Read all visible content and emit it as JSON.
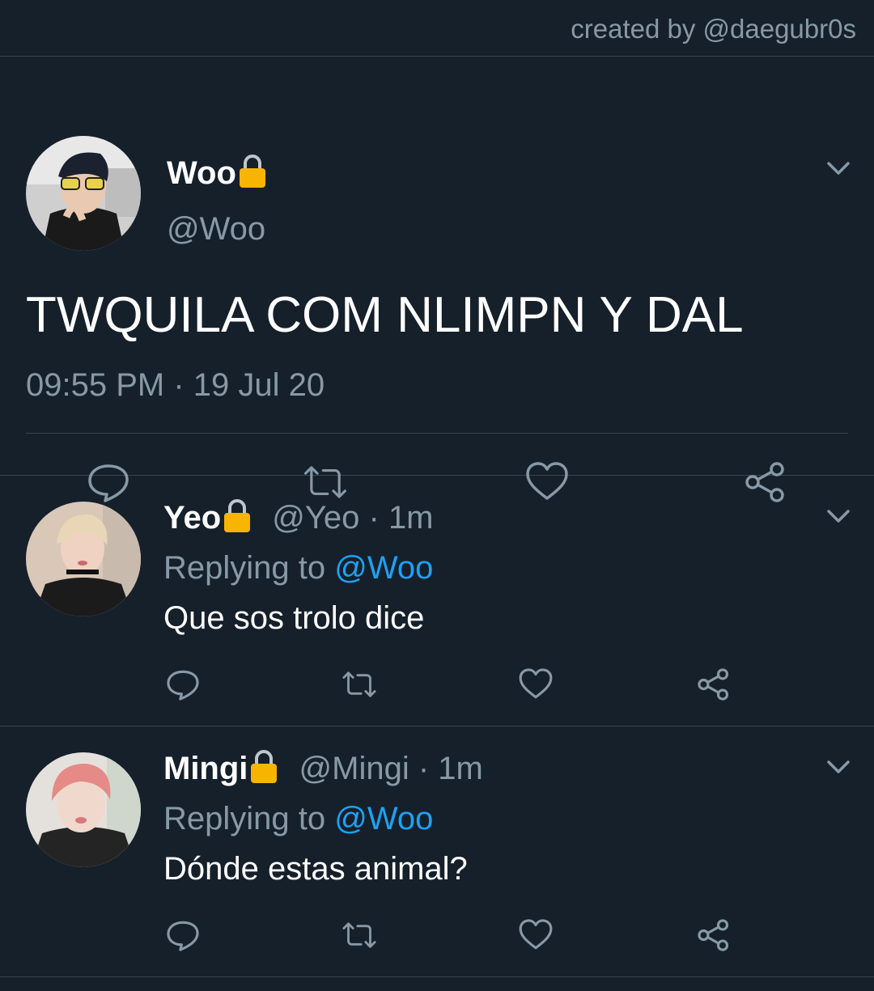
{
  "credit": "created by @daegubr0s",
  "main_tweet": {
    "name": "Woo",
    "handle": "@Woo",
    "text": "TWQUILA COM NLIMPN Y DAL",
    "time": "09:55 PM",
    "date": "19 Jul 20",
    "dot": " · "
  },
  "replies": [
    {
      "name": "Yeo",
      "handle": "@Yeo",
      "sep": " · ",
      "age": "1m",
      "replying_prefix": "Replying to ",
      "mention": "@Woo",
      "text": "Que sos trolo dice"
    },
    {
      "name": "Mingi",
      "handle": "@Mingi",
      "sep": " · ",
      "age": "1m",
      "replying_prefix": "Replying to ",
      "mention": "@Woo",
      "text": "Dónde estas animal?"
    }
  ],
  "colors": {
    "background": "#15202b",
    "divider": "#38444d",
    "secondary_text": "#8899a6",
    "link": "#1da1f2",
    "lock_body": "#f7b500"
  },
  "icons": [
    "lock-icon",
    "chevron-down-icon",
    "reply-icon",
    "retweet-icon",
    "like-icon",
    "share-icon"
  ]
}
